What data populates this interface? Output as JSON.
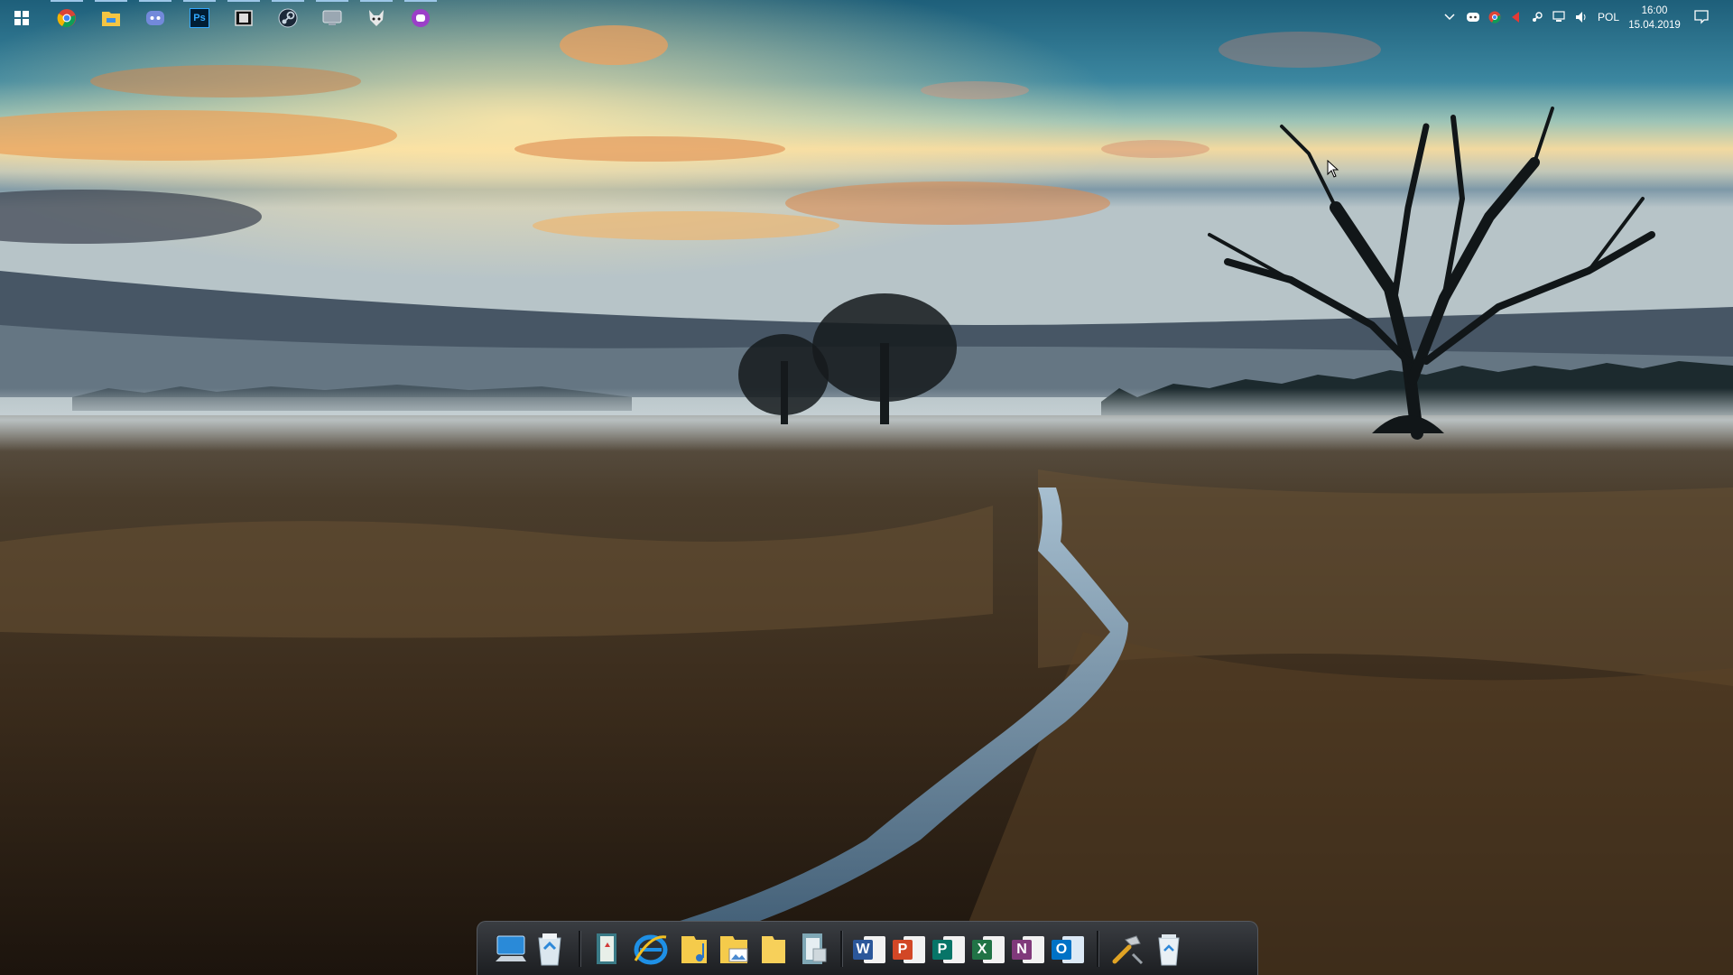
{
  "desktop": {
    "wallpaper": "misty-field-creek-sunrise"
  },
  "taskbar": {
    "start_icon": "windows-start-icon",
    "pinned": [
      {
        "name": "chrome-icon"
      },
      {
        "name": "file-explorer-icon"
      },
      {
        "name": "discord-icon"
      },
      {
        "name": "photoshop-icon",
        "label": "Ps"
      },
      {
        "name": "media-app-icon"
      },
      {
        "name": "steam-icon"
      },
      {
        "name": "monitor-app-icon"
      },
      {
        "name": "fox-app-icon"
      },
      {
        "name": "purple-app-icon"
      }
    ],
    "tray": {
      "language": "POL",
      "time": "16:00",
      "date": "15.04.2019"
    }
  },
  "dock": {
    "items": [
      {
        "name": "computer-icon"
      },
      {
        "name": "recycle-bin-full-icon"
      },
      {
        "name": "book-icon"
      },
      {
        "name": "internet-explorer-icon"
      },
      {
        "name": "music-folder-icon"
      },
      {
        "name": "pictures-folder-icon"
      },
      {
        "name": "documents-folder-icon"
      },
      {
        "name": "library-icon"
      },
      {
        "name": "word-icon",
        "letter": "W",
        "color": "#2b579a"
      },
      {
        "name": "powerpoint-icon",
        "letter": "P",
        "color": "#d24726"
      },
      {
        "name": "publisher-icon",
        "letter": "P",
        "color": "#077568"
      },
      {
        "name": "excel-icon",
        "letter": "X",
        "color": "#217346"
      },
      {
        "name": "onenote-icon",
        "letter": "N",
        "color": "#80397b"
      },
      {
        "name": "outlook-icon",
        "letter": "O",
        "color": "#0072c6"
      },
      {
        "name": "tools-icon"
      },
      {
        "name": "recycle-bin-icon"
      }
    ]
  }
}
